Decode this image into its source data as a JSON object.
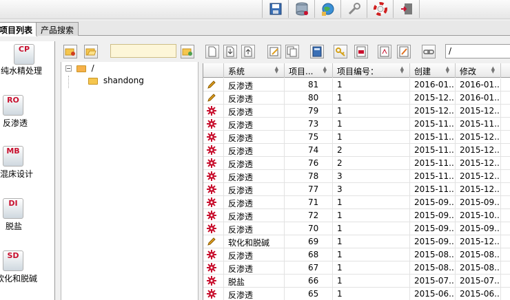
{
  "tabs": [
    {
      "label": "项目列表",
      "active": true
    },
    {
      "label": "产品搜索",
      "active": false
    }
  ],
  "modules": [
    {
      "code": "CP",
      "label": "纯水精处理"
    },
    {
      "code": "RO",
      "label": "反渗透"
    },
    {
      "code": "MB",
      "label": "混床设计"
    },
    {
      "code": "DI",
      "label": "脱盐"
    },
    {
      "code": "SD",
      "label": "软化和脱碱"
    }
  ],
  "tree": {
    "root": "/",
    "child": "shandong"
  },
  "path": "/",
  "columns": [
    "系统",
    "项目...",
    "项目编号：",
    "创建",
    "修改"
  ],
  "rows": [
    {
      "icon": "pencil",
      "system": "反渗透",
      "proj": "81",
      "num": "1",
      "created": "2016-01...",
      "modified": "2016-01..."
    },
    {
      "icon": "pencil",
      "system": "反渗透",
      "proj": "80",
      "num": "1",
      "created": "2015-12...",
      "modified": "2016-01..."
    },
    {
      "icon": "gear",
      "system": "反渗透",
      "proj": "79",
      "num": "1",
      "created": "2015-12...",
      "modified": "2015-12..."
    },
    {
      "icon": "gear",
      "system": "反渗透",
      "proj": "73",
      "num": "1",
      "created": "2015-11...",
      "modified": "2015-11..."
    },
    {
      "icon": "gear",
      "system": "反渗透",
      "proj": "75",
      "num": "1",
      "created": "2015-11...",
      "modified": "2015-12..."
    },
    {
      "icon": "gear",
      "system": "反渗透",
      "proj": "74",
      "num": "2",
      "created": "2015-11...",
      "modified": "2015-12..."
    },
    {
      "icon": "gear",
      "system": "反渗透",
      "proj": "76",
      "num": "2",
      "created": "2015-11...",
      "modified": "2015-12..."
    },
    {
      "icon": "gear",
      "system": "反渗透",
      "proj": "78",
      "num": "3",
      "created": "2015-11...",
      "modified": "2015-12..."
    },
    {
      "icon": "gear",
      "system": "反渗透",
      "proj": "77",
      "num": "3",
      "created": "2015-11...",
      "modified": "2015-12..."
    },
    {
      "icon": "gear",
      "system": "反渗透",
      "proj": "71",
      "num": "1",
      "created": "2015-09...",
      "modified": "2015-09..."
    },
    {
      "icon": "gear",
      "system": "反渗透",
      "proj": "72",
      "num": "1",
      "created": "2015-09...",
      "modified": "2015-10..."
    },
    {
      "icon": "gear",
      "system": "反渗透",
      "proj": "70",
      "num": "1",
      "created": "2015-09...",
      "modified": "2015-09..."
    },
    {
      "icon": "pencil",
      "system": "软化和脱碱",
      "proj": "69",
      "num": "1",
      "created": "2015-09...",
      "modified": "2015-12..."
    },
    {
      "icon": "gear",
      "system": "反渗透",
      "proj": "68",
      "num": "1",
      "created": "2015-08...",
      "modified": "2015-08..."
    },
    {
      "icon": "gear",
      "system": "反渗透",
      "proj": "67",
      "num": "1",
      "created": "2015-08...",
      "modified": "2015-08..."
    },
    {
      "icon": "gear",
      "system": "脱盐",
      "proj": "66",
      "num": "1",
      "created": "2015-07...",
      "modified": "2015-07..."
    },
    {
      "icon": "gear",
      "system": "反渗透",
      "proj": "65",
      "num": "1",
      "created": "2015-06...",
      "modified": "2015-06..."
    }
  ],
  "colors": {
    "gear": "#c8102e",
    "pencil": "#e0a020",
    "folder": "#f5c64e"
  }
}
